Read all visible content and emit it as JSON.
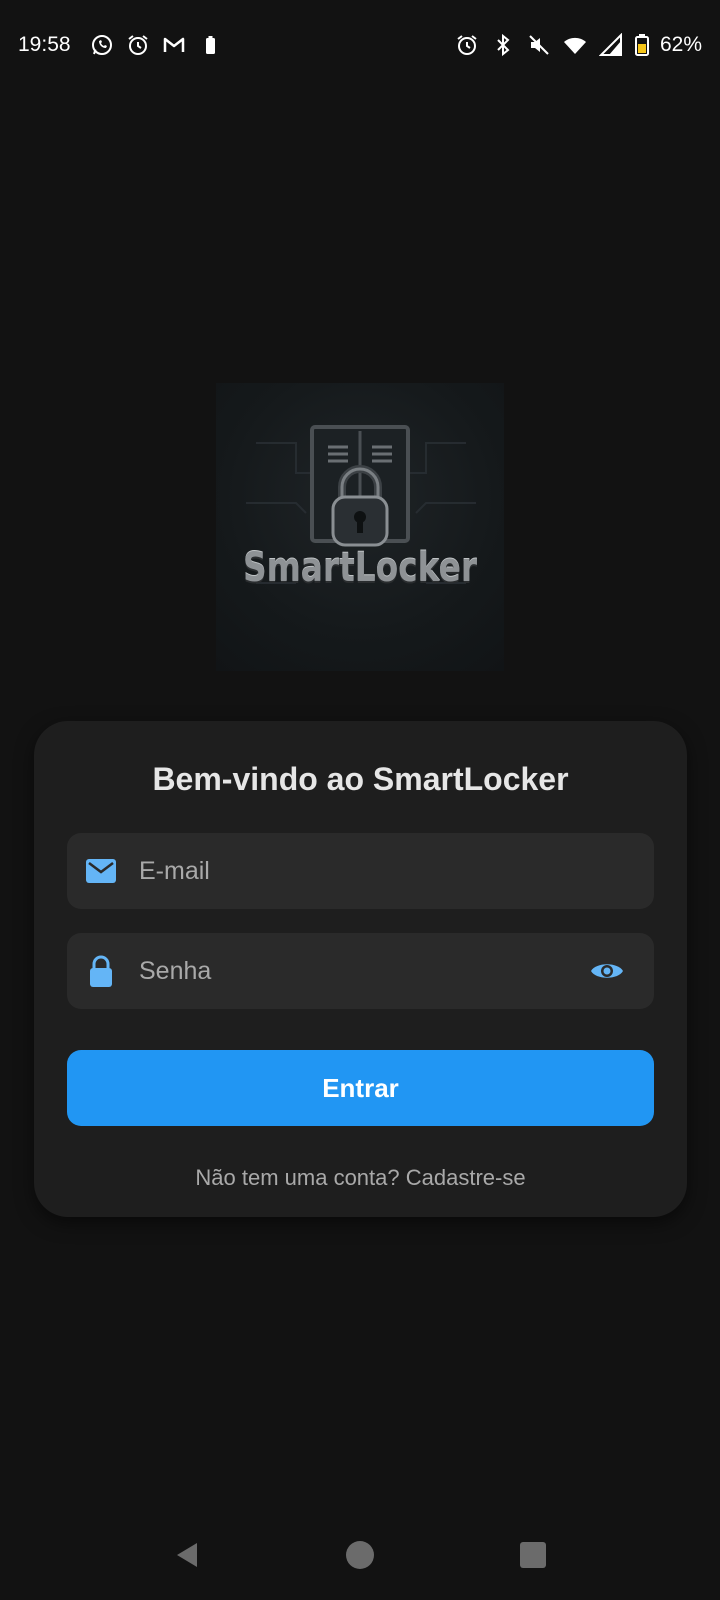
{
  "status_bar": {
    "time": "19:58",
    "battery_percent": "62%",
    "left_icons": [
      "whatsapp-icon",
      "alarm-icon",
      "gmail-icon",
      "battery-small-icon"
    ],
    "right_icons": [
      "alarm-icon",
      "bluetooth-icon",
      "mute-icon",
      "wifi-icon",
      "signal-icon",
      "battery-icon"
    ]
  },
  "logo": {
    "text": "SmartLocker",
    "icon": "locker-padlock-icon"
  },
  "login_card": {
    "title": "Bem-vindo ao SmartLocker",
    "email": {
      "placeholder": "E-mail",
      "value": "",
      "icon": "mail-icon"
    },
    "password": {
      "placeholder": "Senha",
      "value": "",
      "icon": "lock-icon",
      "toggle_icon": "eye-icon"
    },
    "submit_label": "Entrar",
    "signup_text": "Não tem uma conta? Cadastre-se"
  },
  "colors": {
    "background": "#121212",
    "card": "#1e1e1e",
    "field": "#2a2a2a",
    "accent": "#2196f3",
    "icon_accent": "#64b5f6"
  },
  "nav_bar": {
    "buttons": [
      "back-icon",
      "home-icon",
      "recents-icon"
    ]
  }
}
